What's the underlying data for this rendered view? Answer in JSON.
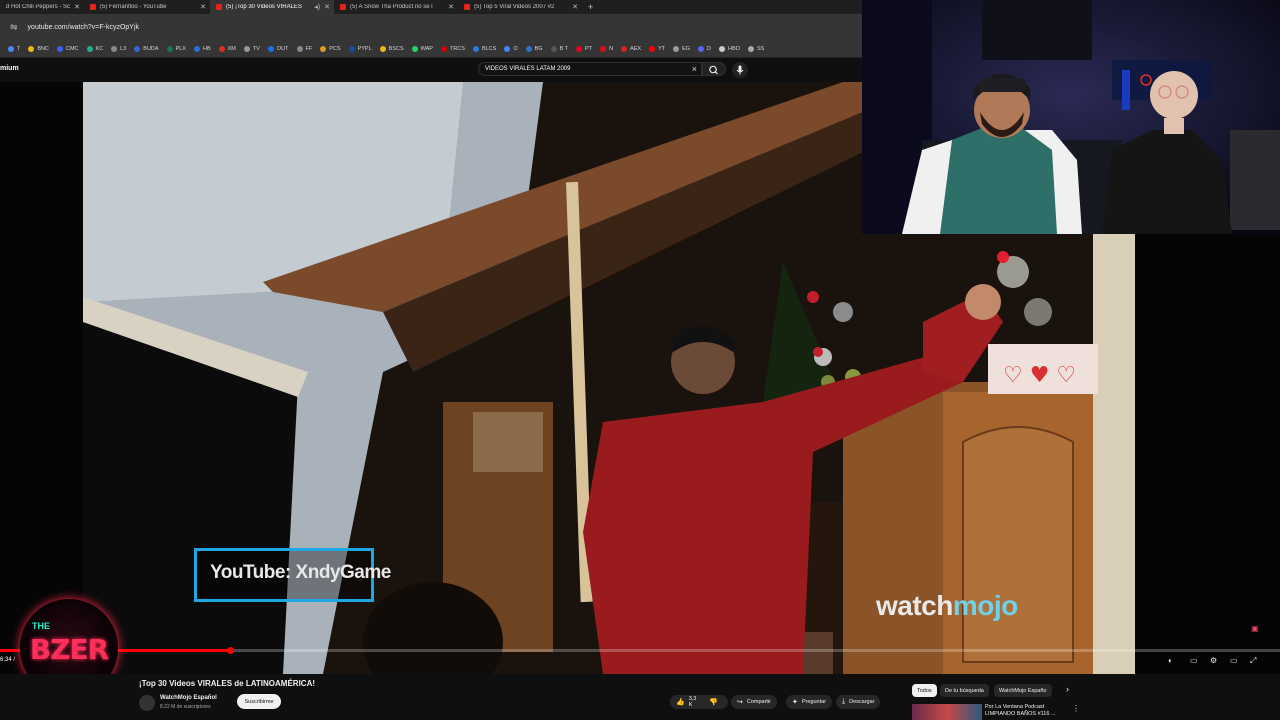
{
  "browser": {
    "tabs": [
      {
        "title": "d Hot Chili Peppers - Scar",
        "active": false
      },
      {
        "title": "(5) Fernanfloo - YouTube",
        "active": false
      },
      {
        "title": "(5) ¡Top 30 Videos VIRALES",
        "active": true
      },
      {
        "title": "(5) A Snow Tha Product no se l",
        "active": false
      },
      {
        "title": "(5) Top 5 Viral Videos 2007 #2",
        "active": false
      }
    ],
    "new_tab": "+",
    "url": "youtube.com/watch?v=F-kcyzOpYjk",
    "bookmarks": [
      {
        "label": "T",
        "color": "#4a8af4"
      },
      {
        "label": "BNC",
        "color": "#f0b90b"
      },
      {
        "label": "CMC",
        "color": "#3861fb"
      },
      {
        "label": "KC",
        "color": "#23af91"
      },
      {
        "label": "L3",
        "color": "#8a8a8a"
      },
      {
        "label": "BUDA",
        "color": "#3b63d8"
      },
      {
        "label": "PLX",
        "color": "#1f6f5c"
      },
      {
        "label": "HB",
        "color": "#2c6fda"
      },
      {
        "label": "XM",
        "color": "#d93025"
      },
      {
        "label": "TV",
        "color": "#999999"
      },
      {
        "label": "OUT",
        "color": "#1a73e8"
      },
      {
        "label": "FF",
        "color": "#888888"
      },
      {
        "label": "PCS",
        "color": "#d99a1e"
      },
      {
        "label": "PYPL",
        "color": "#1a4fa0"
      },
      {
        "label": "BSCS",
        "color": "#f0b90b"
      },
      {
        "label": "WAP",
        "color": "#25d366"
      },
      {
        "label": "TRCS",
        "color": "#cc0000"
      },
      {
        "label": "BLCS",
        "color": "#2a7de1"
      },
      {
        "label": "O",
        "color": "#4285f4"
      },
      {
        "label": "BG",
        "color": "#2d72d2"
      },
      {
        "label": "B T",
        "color": "#555555"
      },
      {
        "label": "PT",
        "color": "#e60023"
      },
      {
        "label": "N",
        "color": "#e50914"
      },
      {
        "label": "AEX",
        "color": "#e02020"
      },
      {
        "label": "YT",
        "color": "#ff0000"
      },
      {
        "label": "EG",
        "color": "#9a9a9a"
      },
      {
        "label": "D",
        "color": "#5865f2"
      },
      {
        "label": "HBO",
        "color": "#cccccc"
      },
      {
        "label": "SS",
        "color": "#aaaaaa"
      }
    ]
  },
  "masthead": {
    "logo_text": "mium",
    "search_value": "VIDEOS VIRALES LATAM 2009",
    "clear_icon": "×",
    "search_icon": "⌕",
    "mic_icon": "🎙"
  },
  "video": {
    "overlay_text": "YouTube: XndyGame",
    "watermark_a": "watch",
    "watermark_b": "mojo",
    "time": "6:34 /",
    "progress": 0.18
  },
  "below": {
    "title": "¡Top 30 Videos VIRALES de LATINOAMÉRICA!",
    "channel": "WatchMojo Español",
    "subscribers": "8,22 M de suscriptores",
    "subscribe": "Suscribirme",
    "likes": "3,3 K",
    "share": "Compartir",
    "ask": "Preguntar",
    "download": "Descargar",
    "chips": [
      "Todos",
      "De tu búsqueda",
      "WatchMojo Españo"
    ],
    "rec_title_1": "Por La Ventana Podcast",
    "rec_title_2": "LIMPIANDO BAÑOS #116 ..."
  },
  "stream_logo": {
    "top": "THE",
    "main": "BZER"
  },
  "colors": {
    "accent": "#ff0000",
    "watchmojo_blue": "#6fd1ea",
    "overlay_border": "#1ea7e0"
  }
}
